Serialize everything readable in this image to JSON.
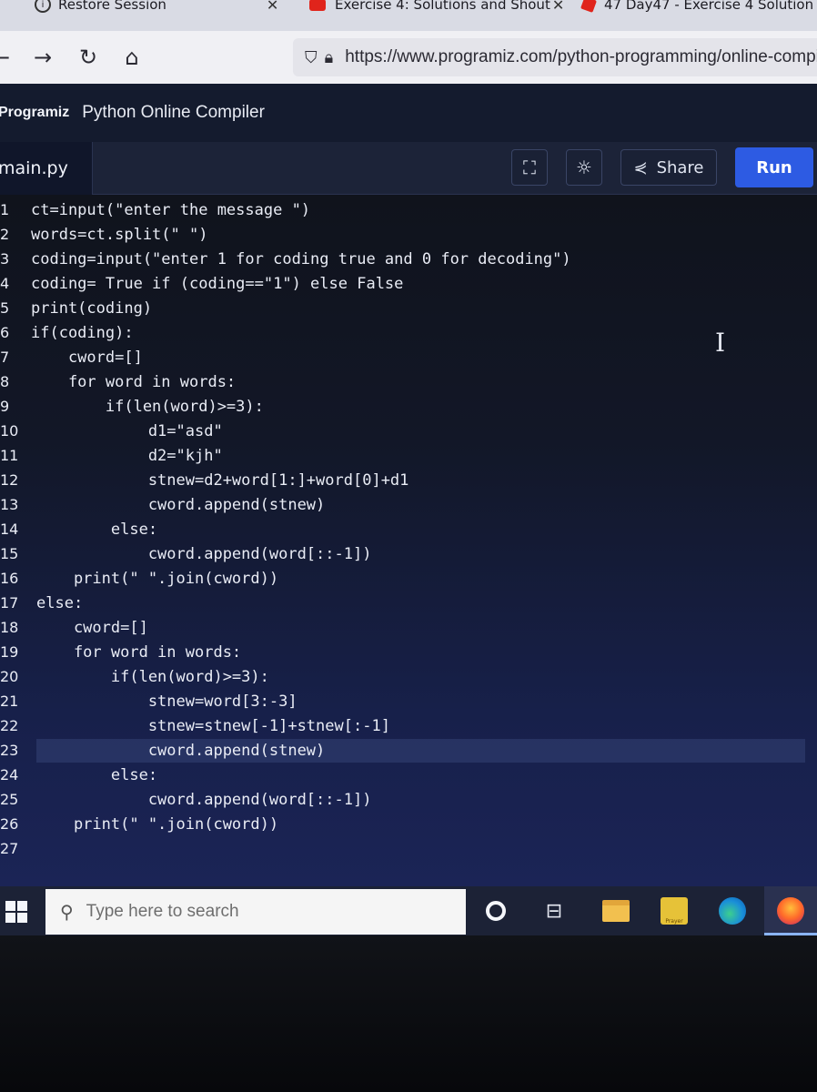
{
  "browser": {
    "tabs": [
      {
        "label": "Restore Session",
        "icon": "info-circle-icon"
      },
      {
        "label": "Exercise 4: Solutions and Shout",
        "icon": "youtube-icon"
      },
      {
        "label": "47 Day47 - Exercise 4 Solution",
        "icon": "codewithharry-icon"
      }
    ],
    "url": "https://www.programiz.com/python-programming/online-compiler"
  },
  "site": {
    "brand": "Programiz",
    "title": "Python Online Compiler"
  },
  "editor_bar": {
    "file_tab": "main.py",
    "share_label": "Share",
    "run_label": "Run"
  },
  "code_lines": [
    {
      "n": "1",
      "text": "ct=input(\"enter the message \")"
    },
    {
      "n": "2",
      "text": "words=ct.split(\" \")"
    },
    {
      "n": "3",
      "text": "coding=input(\"enter 1 for coding true and 0 for decoding\")"
    },
    {
      "n": "4",
      "text": "coding= True if (coding==\"1\") else False"
    },
    {
      "n": "5",
      "text": "print(coding)"
    },
    {
      "n": "6",
      "text": "if(coding):"
    },
    {
      "n": "7",
      "text": "    cword=[]"
    },
    {
      "n": "8",
      "text": "    for word in words:"
    },
    {
      "n": "9",
      "text": "        if(len(word)>=3):"
    },
    {
      "n": "10",
      "text": "            d1=\"asd\""
    },
    {
      "n": "11",
      "text": "            d2=\"kjh\""
    },
    {
      "n": "12",
      "text": "            stnew=d2+word[1:]+word[0]+d1"
    },
    {
      "n": "13",
      "text": "            cword.append(stnew)"
    },
    {
      "n": "14",
      "text": "        else:"
    },
    {
      "n": "15",
      "text": "            cword.append(word[::-1])"
    },
    {
      "n": "16",
      "text": "    print(\" \".join(cword))"
    },
    {
      "n": "17",
      "text": "else:"
    },
    {
      "n": "18",
      "text": "    cword=[]"
    },
    {
      "n": "19",
      "text": "    for word in words:"
    },
    {
      "n": "20",
      "text": "        if(len(word)>=3):"
    },
    {
      "n": "21",
      "text": "            stnew=word[3:-3]"
    },
    {
      "n": "22",
      "text": "            stnew=stnew[-1]+stnew[:-1]"
    },
    {
      "n": "23",
      "text": "            cword.append(stnew)"
    },
    {
      "n": "24",
      "text": "        else:"
    },
    {
      "n": "25",
      "text": "            cword.append(word[::-1])"
    },
    {
      "n": "26",
      "text": "    print(\" \".join(cword))"
    },
    {
      "n": "27",
      "text": ""
    }
  ],
  "active_line": "23",
  "taskbar": {
    "search_placeholder": "Type here to search",
    "apps": [
      "cortana-icon",
      "task-view-icon",
      "file-explorer-icon",
      "prayer-app-icon",
      "edge-icon",
      "firefox-icon"
    ],
    "prayer_label": "Prayer"
  },
  "colors": {
    "run_button": "#2d5be3",
    "keyword": "#f0a24a",
    "number": "#ff5a5a"
  }
}
